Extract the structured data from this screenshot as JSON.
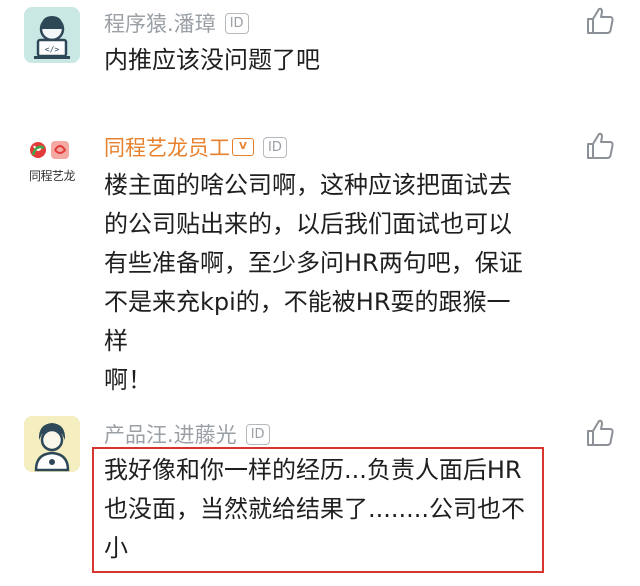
{
  "comments": [
    {
      "name": "程序猿.潘璋",
      "id_badge": "ID",
      "text": "内推应该没问题了吧",
      "avatar_icon": "programmer-avatar-icon"
    },
    {
      "name": "同程艺龙员工",
      "vip_badge": "V",
      "id_badge": "ID",
      "text": "楼主面的啥公司啊，这种应该把面试去\n的公司贴出来的，以后我们面试也可以\n有些准备啊，至少多问HR两句吧，保证\n不是来充kpi的，不能被HR耍的跟猴一样\n啊！",
      "avatar_icon": "company-logo-icon",
      "avatar_label": "同程艺龙"
    },
    {
      "name": "产品汪.进藤光",
      "id_badge": "ID",
      "text": "我好像和你一样的经历...负责人面后HR\n也没面，当然就给结果了........公司也不\n小",
      "avatar_icon": "product-manager-avatar-icon"
    }
  ],
  "colors": {
    "name_gray": "#9aa0a6",
    "name_orange": "#e8812e",
    "highlight_red": "#d8352e"
  }
}
